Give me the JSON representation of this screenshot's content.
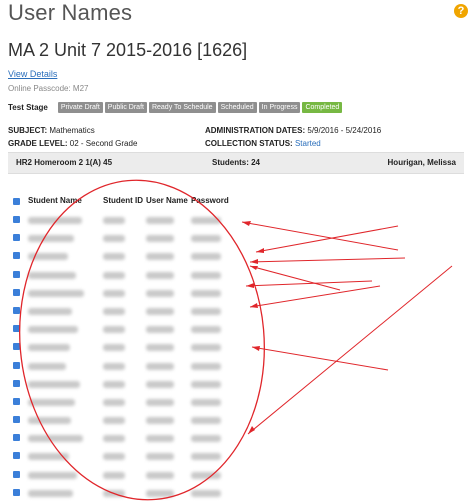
{
  "page": {
    "title": "User Names",
    "help_icon_glyph": "?",
    "test_name": "MA 2 Unit 7 2015-2016 [1626]",
    "view_details": "View Details",
    "passcode": "Online Passcode: M27"
  },
  "test_stage": {
    "label": "Test Stage",
    "stages": [
      "Private Draft",
      "Public Draft",
      "Ready To Schedule",
      "Scheduled",
      "In Progress",
      "Completed"
    ],
    "active_stage": "Completed"
  },
  "meta": {
    "subject_label": "SUBJECT:",
    "subject": "Mathematics",
    "grade_label": "GRADE LEVEL:",
    "grade": "02 - Second Grade",
    "admin_dates_label": "ADMINISTRATION DATES:",
    "admin_dates": "5/9/2016 - 5/24/2016",
    "collection_label": "COLLECTION STATUS:",
    "collection_status": "Started"
  },
  "class_bar": {
    "class_name": "HR2 Homeroom 2 1(A) 45",
    "students": "Students: 24",
    "teacher": "Hourigan, Melissa"
  },
  "table": {
    "columns": [
      "Student Name",
      "Student ID",
      "User Name",
      "Password"
    ],
    "row_count_visible": 16,
    "row_content": "blurred"
  },
  "colors": {
    "accent": "#2a6ebb",
    "checkbox": "#3b7fd9",
    "stage_inactive": "#8f8f8f",
    "stage_active": "#77b843",
    "annotation": "#e0262b"
  }
}
